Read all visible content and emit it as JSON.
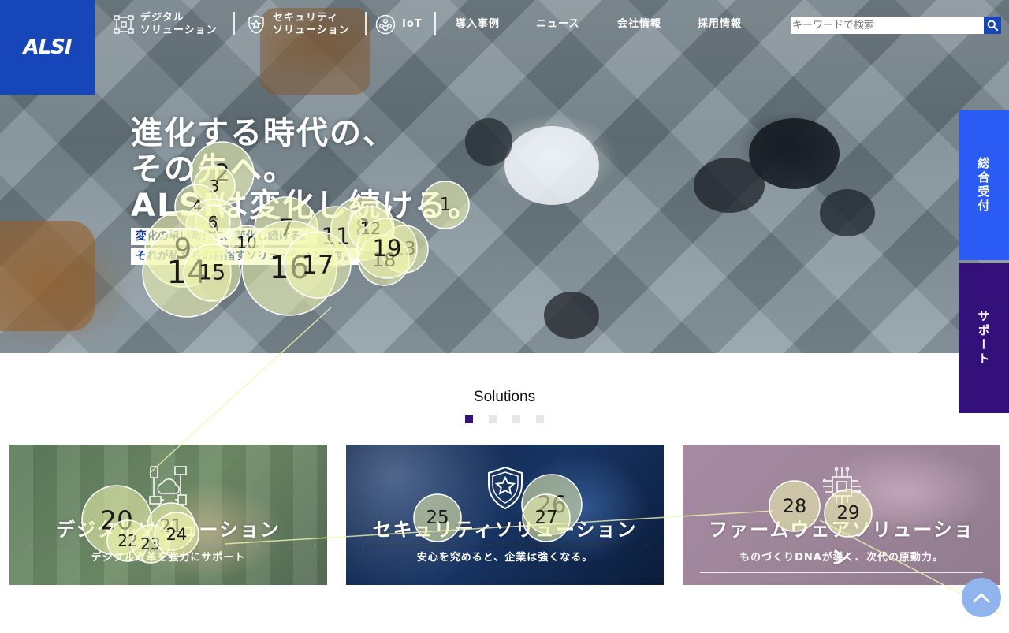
{
  "header": {
    "logo": "ALSI",
    "nav": [
      {
        "label": "デジタル\nソリューション",
        "icon": "digital-network-icon"
      },
      {
        "label": "セキュリティ\nソリューション",
        "icon": "shield-star-icon"
      },
      {
        "label": "IoT",
        "icon": "iot-chip-icon"
      },
      {
        "label": "導入事例"
      },
      {
        "label": "ニュース"
      },
      {
        "label": "会社情報"
      },
      {
        "label": "採用情報"
      }
    ],
    "search": {
      "placeholder": "キーワードで検索",
      "value": ""
    }
  },
  "hero": {
    "title_lines": [
      "進化する時代の、",
      "その先へ。",
      "ALSIは変化し続ける。"
    ],
    "sub_lines": [
      "変化の早い時代に、変化し続ける。",
      "それが私たちの目指すソリューションです。"
    ]
  },
  "side_tabs": [
    "総合受付",
    "サポート"
  ],
  "solutions": {
    "title": "Solutions",
    "carousel_active": 1,
    "cards": [
      {
        "title": "デジタルソリューション",
        "sub": "デジタル改革を強力にサポート",
        "icon": "digital-cloud-icon"
      },
      {
        "title": "セキュリティソリューション",
        "sub": "安心を究めると、企業は強くなる。",
        "icon": "shield-star-icon"
      },
      {
        "title": "ファームウェアソリューション",
        "sub": "ものづくりDNAが導く、次代の原動力。",
        "icon": "chip-circuit-icon"
      }
    ]
  },
  "overlay_markers": [
    "1",
    "2",
    "3",
    "4",
    "5",
    "6",
    "7",
    "8",
    "9",
    "10",
    "11",
    "12",
    "13",
    "14",
    "15",
    "16",
    "17",
    "18",
    "19",
    "20",
    "21",
    "22",
    "23",
    "24",
    "25",
    "26",
    "27",
    "28",
    "29"
  ],
  "colors": {
    "brand_blue": "#1746b8",
    "tab_blue": "#2b5bf5",
    "tab_purple": "#33107a",
    "marker_fill": "#f3f7b0"
  }
}
